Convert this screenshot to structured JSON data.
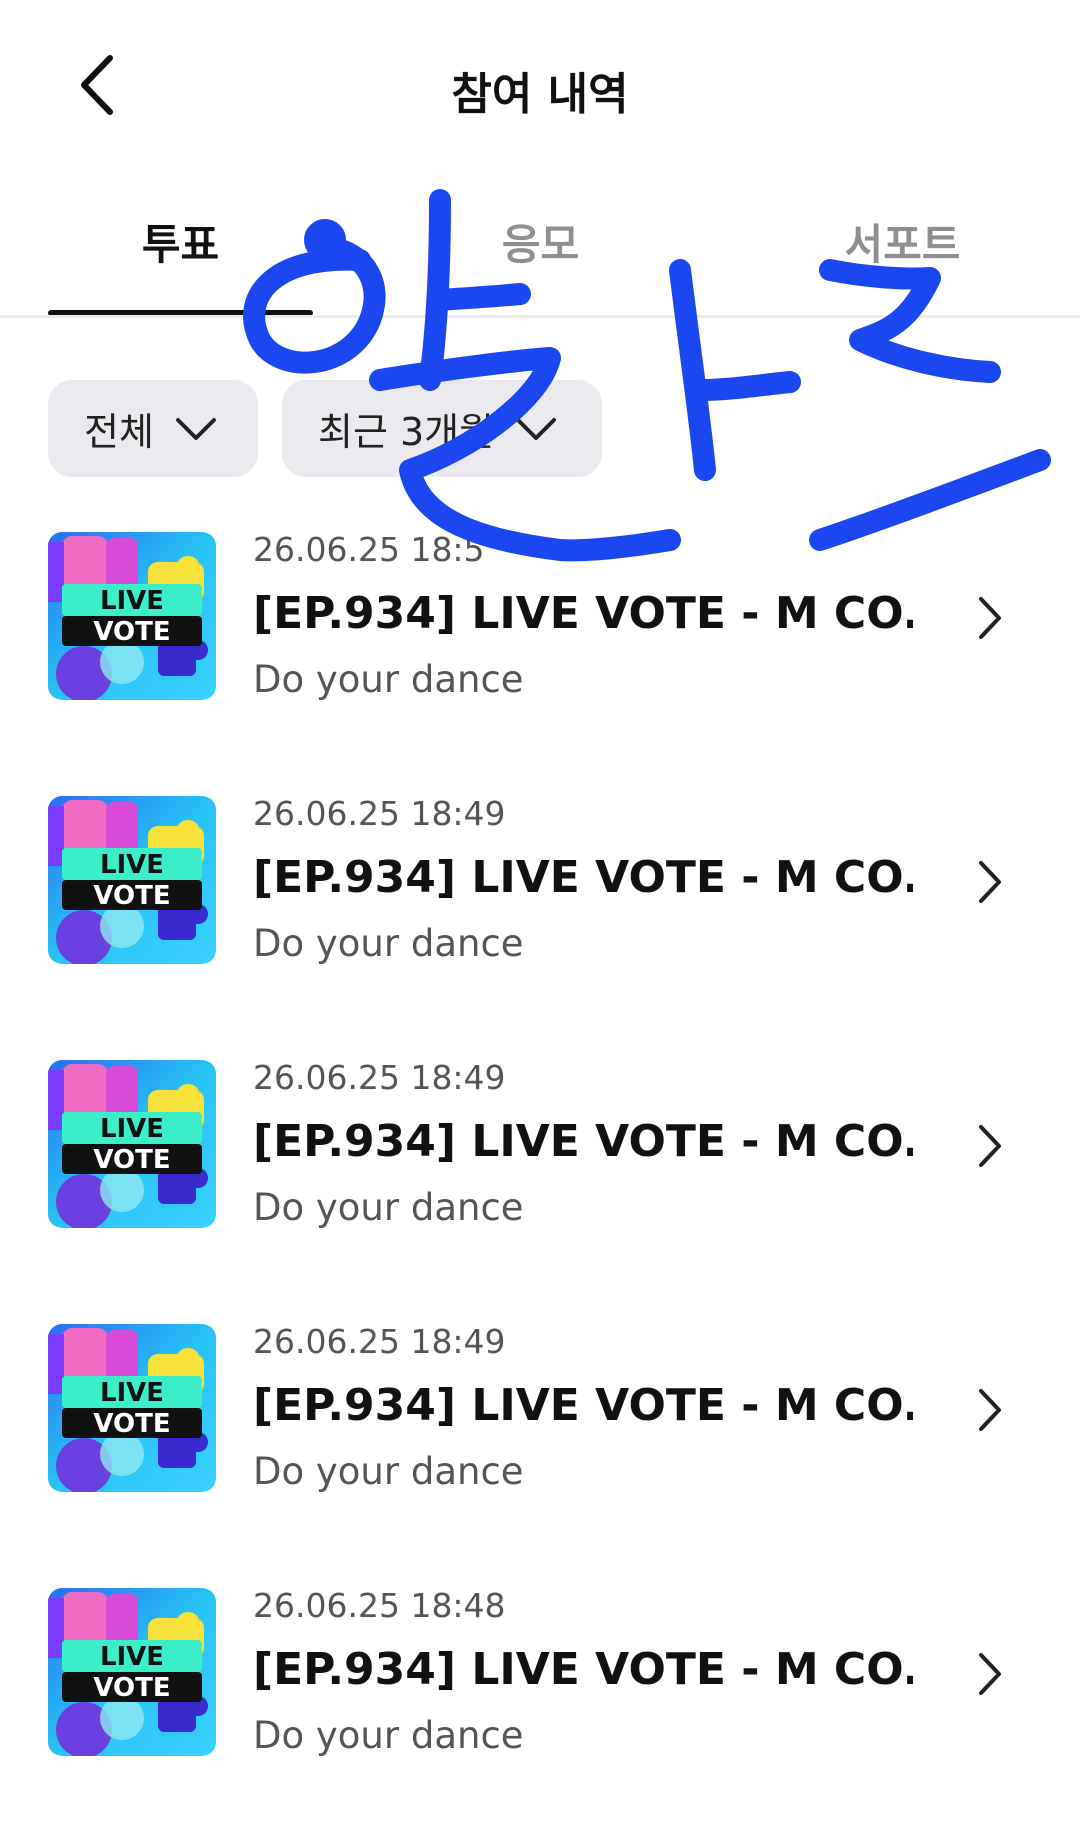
{
  "header": {
    "title": "참여 내역",
    "back_icon": "chevron-left-icon"
  },
  "tabs": [
    {
      "label": "투표",
      "active": true
    },
    {
      "label": "응모",
      "active": false
    },
    {
      "label": "서포트",
      "active": false
    }
  ],
  "filters": {
    "type_label": "전체",
    "period_label": "최근 3개월",
    "dropdown_icon": "chevron-down-icon"
  },
  "items": [
    {
      "date": "26.06.25 18:5",
      "title": "[EP.934] LIVE VOTE - M CO...",
      "subtitle": "Do your dance"
    },
    {
      "date": "26.06.25 18:49",
      "title": "[EP.934] LIVE VOTE - M CO...",
      "subtitle": "Do your dance"
    },
    {
      "date": "26.06.25 18:49",
      "title": "[EP.934] LIVE VOTE - M CO...",
      "subtitle": "Do your dance"
    },
    {
      "date": "26.06.25 18:49",
      "title": "[EP.934] LIVE VOTE - M CO...",
      "subtitle": "Do your dance"
    },
    {
      "date": "26.06.25 18:48",
      "title": "[EP.934] LIVE VOTE - M CO...",
      "subtitle": "Do your dance"
    }
  ],
  "thumbnail": {
    "line1": "LIVE",
    "line2": "VOTE"
  },
  "colors": {
    "scribble": "#1a47f0",
    "active_text": "#111111",
    "inactive_text": "#8e8e93",
    "filter_bg": "#eaeaee"
  }
}
